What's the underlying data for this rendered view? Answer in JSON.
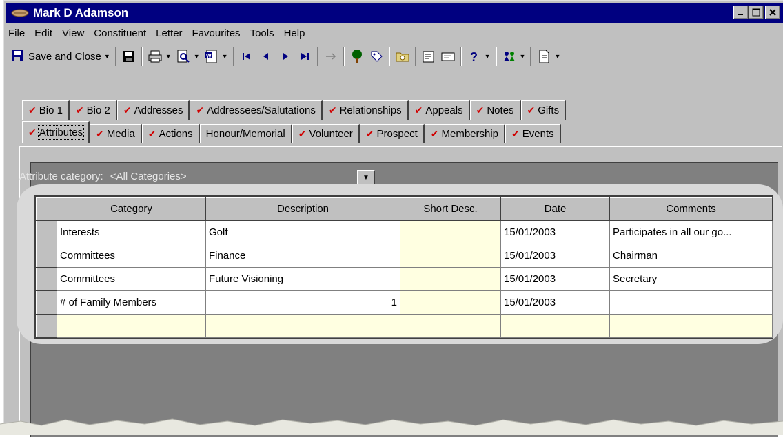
{
  "window": {
    "title": "Mark D Adamson",
    "controls": [
      "_",
      "□",
      "X"
    ]
  },
  "menu": [
    "File",
    "Edit",
    "View",
    "Constituent",
    "Letter",
    "Favourites",
    "Tools",
    "Help"
  ],
  "toolbar": {
    "save_close_label": "Save and Close"
  },
  "tabs": {
    "row1": [
      {
        "label": "Bio 1",
        "checked": true
      },
      {
        "label": "Bio 2",
        "checked": true
      },
      {
        "label": "Addresses",
        "checked": true
      },
      {
        "label": "Addressees/Salutations",
        "checked": true
      },
      {
        "label": "Relationships",
        "checked": true
      },
      {
        "label": "Appeals",
        "checked": true
      },
      {
        "label": "Notes",
        "checked": true
      },
      {
        "label": "Gifts",
        "checked": true
      }
    ],
    "row2": [
      {
        "label": "Attributes",
        "checked": true,
        "active": true
      },
      {
        "label": "Media",
        "checked": true
      },
      {
        "label": "Actions",
        "checked": true
      },
      {
        "label": "Honour/Memorial",
        "checked": false
      },
      {
        "label": "Volunteer",
        "checked": true
      },
      {
        "label": "Prospect",
        "checked": true
      },
      {
        "label": "Membership",
        "checked": true
      },
      {
        "label": "Events",
        "checked": true
      }
    ]
  },
  "attribute_filter": {
    "label": "Attribute category:",
    "value": "<All Categories>"
  },
  "grid": {
    "columns": [
      "Category",
      "Description",
      "Short Desc.",
      "Date",
      "Comments"
    ],
    "rows": [
      [
        "Interests",
        "Golf",
        "",
        "15/01/2003",
        "Participates in all our go..."
      ],
      [
        "Committees",
        "Finance",
        "",
        "15/01/2003",
        "Chairman"
      ],
      [
        "Committees",
        "Future Visioning",
        "",
        "15/01/2003",
        "Secretary"
      ],
      [
        "# of Family Members",
        "1",
        "",
        "15/01/2003",
        ""
      ],
      [
        "",
        "",
        "",
        "",
        ""
      ]
    ]
  },
  "colors": {
    "title_bar": "#000080",
    "check": "#d00000",
    "entry_cell": "#ffffe1"
  }
}
